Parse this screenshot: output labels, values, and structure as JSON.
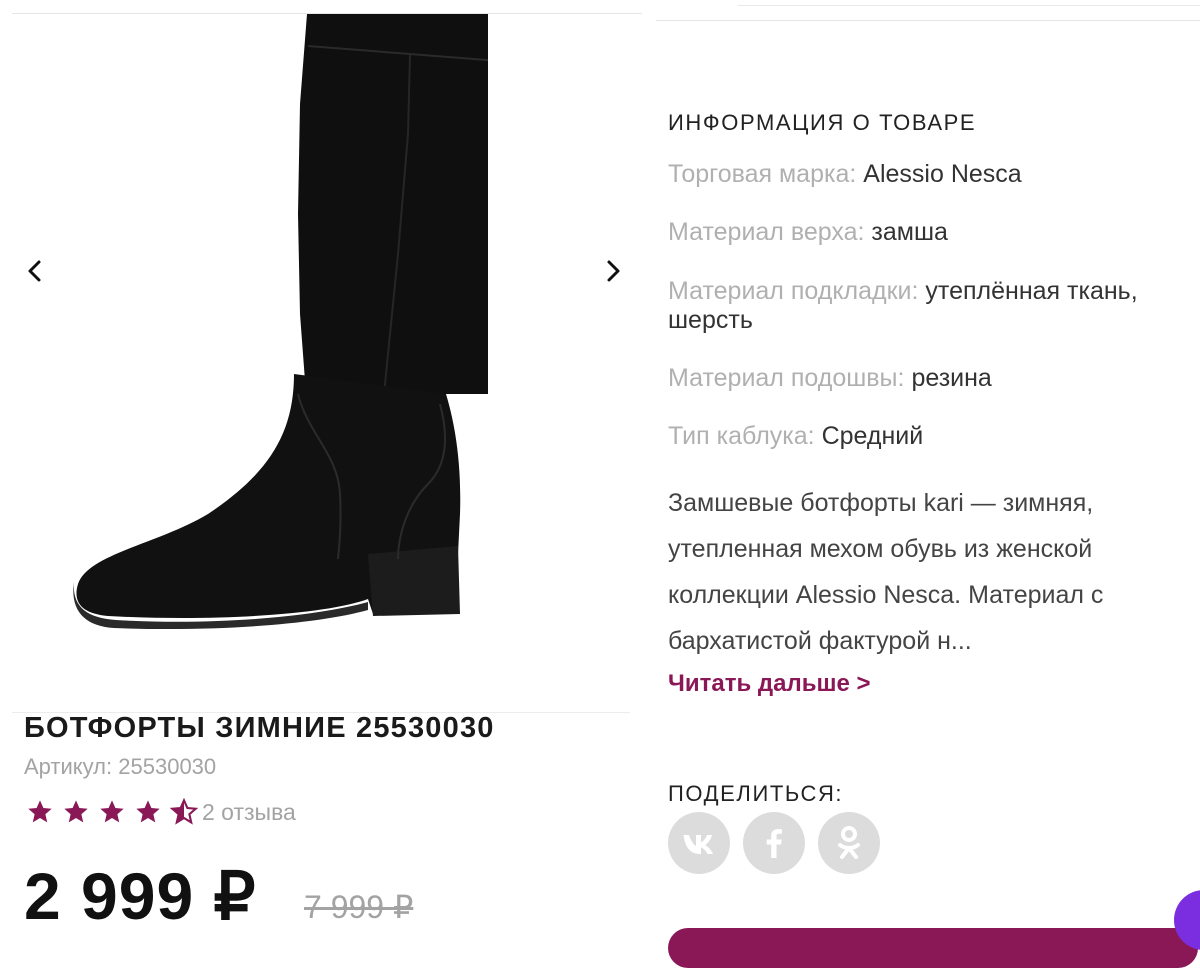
{
  "gallery": {
    "prev_icon": "chevron-left-icon",
    "next_icon": "chevron-right-icon",
    "image_alt": "boot"
  },
  "product": {
    "title": "БОТФОРТЫ ЗИМНИЕ 25530030",
    "sku_label": "Артикул:",
    "sku_value": "25530030",
    "rating": 4.5,
    "rating_max": 5,
    "reviews_label": "2 отзыва",
    "price": "2 999 ₽",
    "old_price": "7 999 ₽"
  },
  "info": {
    "section_title": "ИНФОРМАЦИЯ О ТОВАРЕ",
    "attributes": [
      {
        "key": "Торговая марка:",
        "value": "Alessio Nesca"
      },
      {
        "key": "Материал верха:",
        "value": "замша"
      },
      {
        "key": "Материал подкладки:",
        "value": "утеплённая ткань, шерсть"
      },
      {
        "key": "Материал подошвы:",
        "value": "резина"
      },
      {
        "key": "Тип каблука:",
        "value": "Средний"
      }
    ],
    "description": "Замшевые ботфорты kari — зимняя, утепленная мехом обувь из женской коллекции Alessio Nesca. Материал с бархатистой фактурой н...",
    "read_more": "Читать дальше >"
  },
  "share": {
    "title": "ПОДЕЛИТЬСЯ:",
    "networks": [
      "vk-icon",
      "facebook-icon",
      "odnoklassniki-icon"
    ]
  },
  "colors": {
    "accent": "#8a1857",
    "star": "#8a1857",
    "muted": "#a3a3a3",
    "social_bg": "#dcdcdc",
    "chat": "#7b2ee0"
  }
}
